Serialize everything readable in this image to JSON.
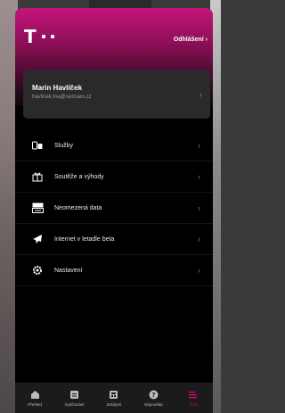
{
  "header": {
    "logo_text": "T",
    "logout_label": "Odhlášení",
    "logout_chevron": "›"
  },
  "user": {
    "name": "Marin Havlíček",
    "email": "havlicek.ma@seznam.cz",
    "chevron": "›"
  },
  "menu": {
    "items": [
      {
        "label": "Služby",
        "icon": "sim-services-icon"
      },
      {
        "label": "Soutěže a výhody",
        "icon": "gift-icon"
      },
      {
        "label": "Neomezená data",
        "icon": "unlimited-data-icon"
      },
      {
        "label": "Internet v letadle beta",
        "icon": "airplane-icon"
      },
      {
        "label": "Nastavení",
        "icon": "gear-icon"
      }
    ],
    "chevron": "›"
  },
  "bottom_nav": {
    "items": [
      {
        "label": "Přehled",
        "icon": "home-icon",
        "active": false
      },
      {
        "label": "Vyúčtování",
        "icon": "billing-icon",
        "active": false
      },
      {
        "label": "Dobíjení",
        "icon": "topup-icon",
        "active": false
      },
      {
        "label": "Nápověda",
        "icon": "help-icon",
        "active": false
      },
      {
        "label": "Více",
        "icon": "more-icon",
        "active": true
      }
    ]
  },
  "colors": {
    "brand_magenta": "#e20074",
    "background": "#000000",
    "card": "#2a2a2a"
  }
}
